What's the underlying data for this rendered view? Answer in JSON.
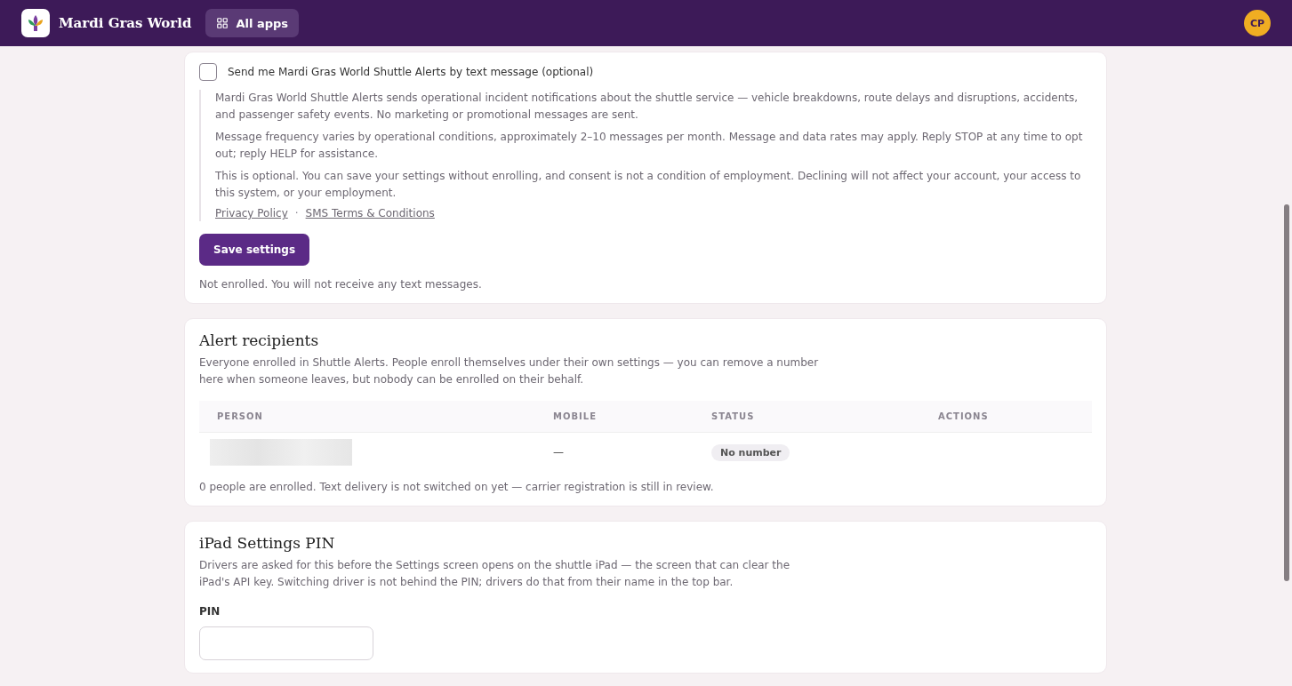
{
  "header": {
    "brand": "Mardi Gras World",
    "apps_button": "All apps",
    "avatar": "CP"
  },
  "sms_card": {
    "checkbox": {
      "label": "Send me Mardi Gras World Shuttle Alerts by text message (optional)",
      "checked": false
    },
    "paragraphs": [
      "Mardi Gras World Shuttle Alerts sends operational incident notifications about the shuttle service — vehicle breakdowns, route delays and disruptions, accidents, and passenger safety events. No marketing or promotional messages are sent.",
      "Message frequency varies by operational conditions, approximately 2–10 messages per month. Message and data rates may apply. Reply STOP at any time to opt out; reply HELP for assistance.",
      "This is optional. You can save your settings without enrolling, and consent is not a condition of employment. Declining will not affect your account, your access to this system, or your employment."
    ],
    "links": [
      "Privacy Policy",
      "SMS Terms & Conditions"
    ],
    "link_separator": "·",
    "save_button": "Save settings",
    "status": "Not enrolled. You will not receive any text messages."
  },
  "recipients_card": {
    "title": "Alert recipients",
    "description": "Everyone enrolled in Shuttle Alerts. People enroll themselves under their own settings — you can remove a number here when someone leaves, but nobody can be enrolled on their behalf.",
    "table": {
      "columns": [
        "PERSON",
        "MOBILE",
        "STATUS",
        "ACTIONS"
      ],
      "rows": [
        {
          "mobile": "—",
          "status": "No number"
        }
      ]
    },
    "footer": "0 people are enrolled. Text delivery is not switched on yet — carrier registration is still in review."
  },
  "pin_card": {
    "title": "iPad Settings PIN",
    "description": "Drivers are asked for this before the Settings screen opens on the shuttle iPad — the screen that can clear the iPad's API key. Switching driver is not behind the PIN; drivers do that from their name in the top bar.",
    "field_label": "PIN"
  }
}
